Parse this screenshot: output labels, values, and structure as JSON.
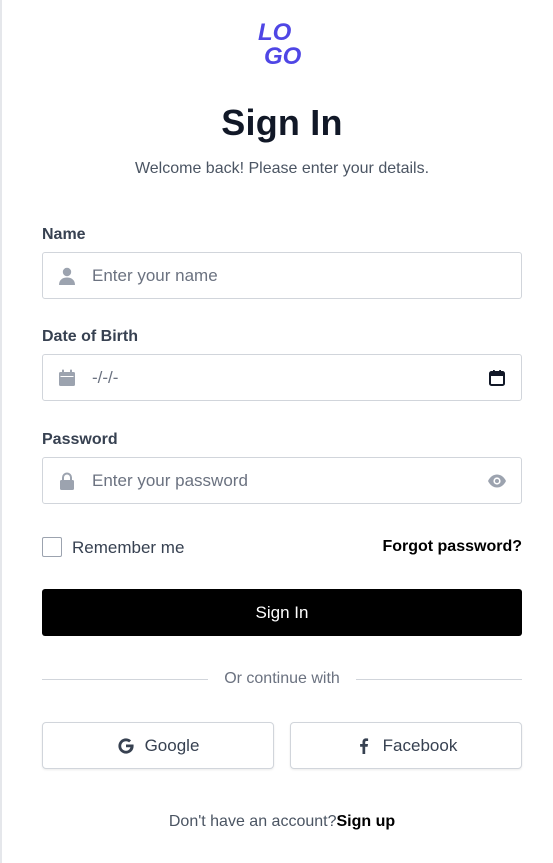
{
  "logo": {
    "line1": "LO",
    "line2": "GO",
    "color": "#4f46e5"
  },
  "header": {
    "title": "Sign In",
    "subtitle": "Welcome back! Please enter your details."
  },
  "form": {
    "name": {
      "label": "Name",
      "placeholder": "Enter your name",
      "icon": "user-icon"
    },
    "dob": {
      "label": "Date of Birth",
      "value": "-/-/-",
      "icon": "calendar-icon",
      "trailing_icon": "calendar-picker-icon"
    },
    "password": {
      "label": "Password",
      "placeholder": "Enter your password",
      "icon": "lock-icon",
      "trailing_icon": "eye-icon"
    },
    "remember_label": "Remember me",
    "remember_checked": false,
    "forgot_label": "Forgot password?",
    "submit_label": "Sign In"
  },
  "divider": {
    "label": "Or continue with"
  },
  "social": {
    "google_label": "Google",
    "facebook_label": "Facebook"
  },
  "footer": {
    "prompt": "Don't have an account?",
    "signup_label": "Sign up"
  },
  "colors": {
    "primary": "#000000",
    "accent": "#4f46e5",
    "border": "#d1d5db",
    "muted_text": "#6b7280",
    "icon": "#9ca3af"
  }
}
